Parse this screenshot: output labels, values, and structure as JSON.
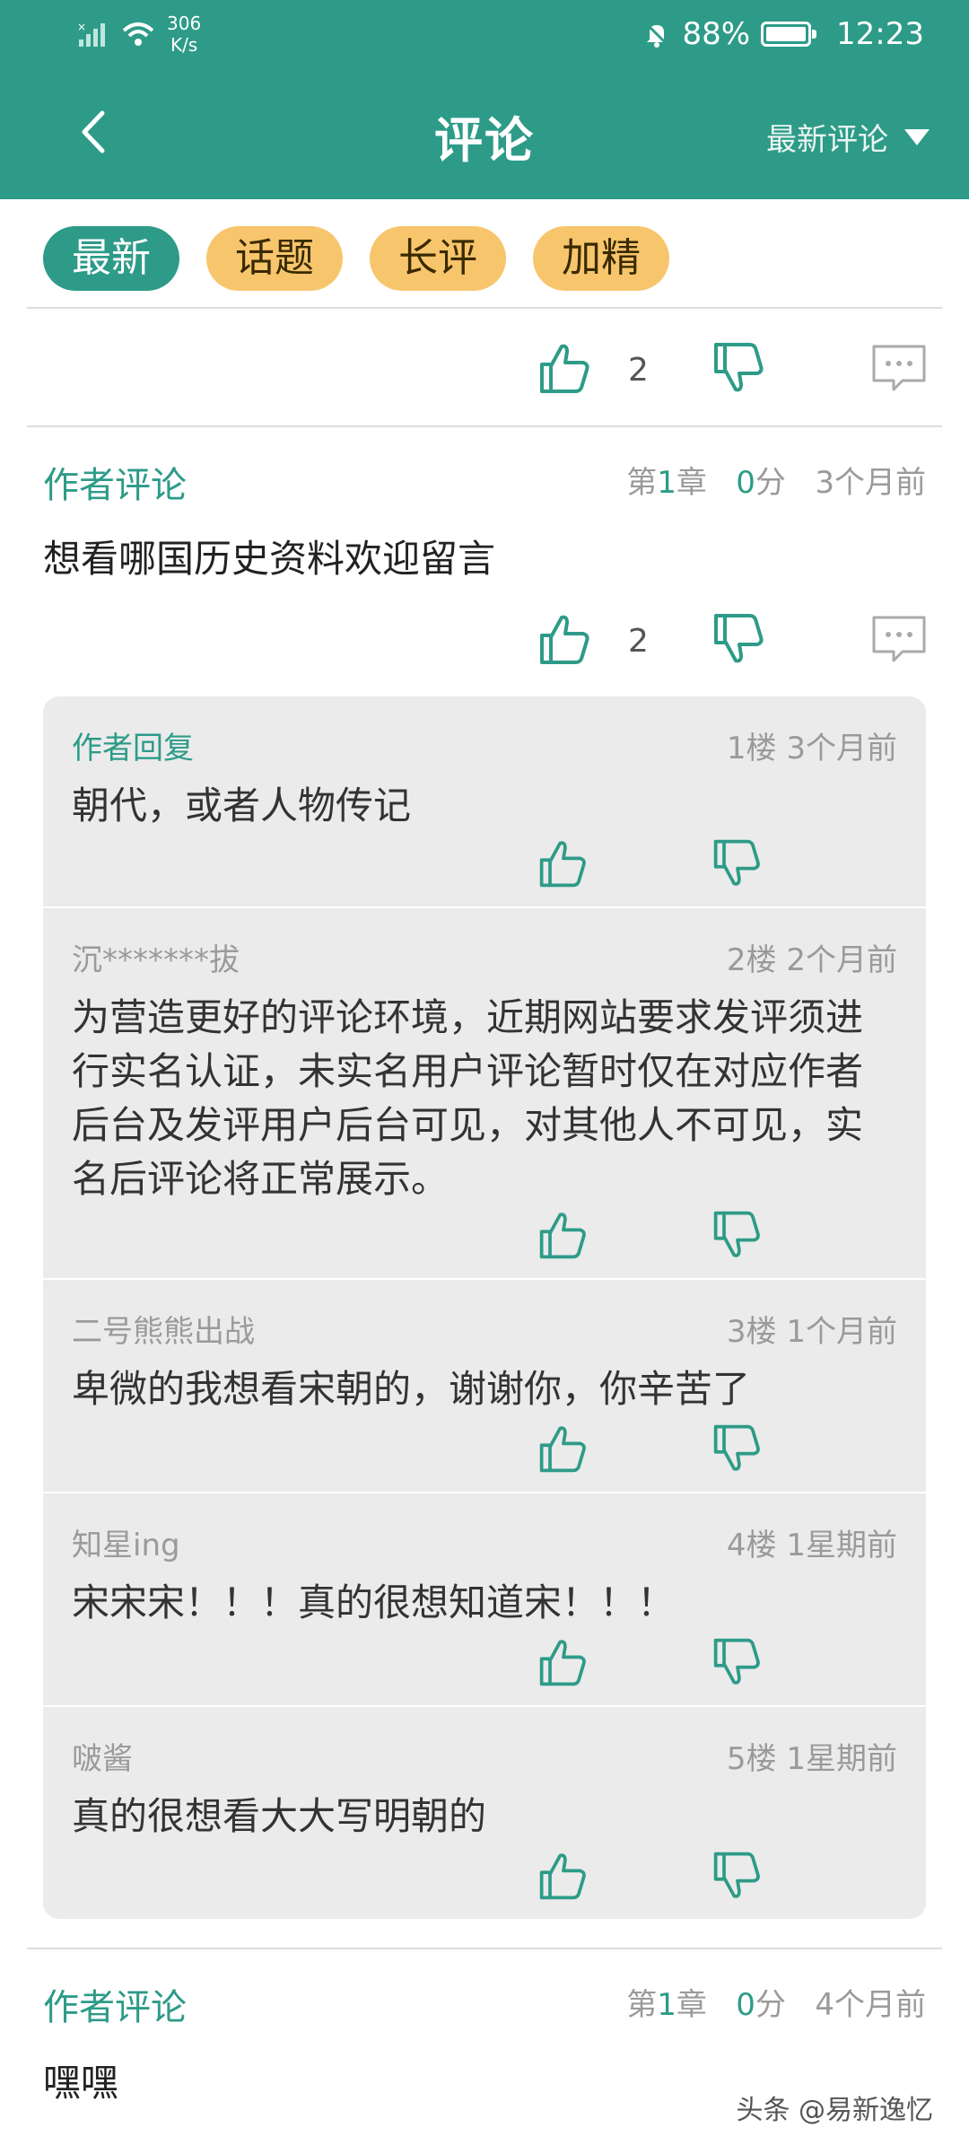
{
  "status": {
    "net_speed_value": "306",
    "net_speed_unit": "K/s",
    "battery": "88%",
    "time": "12:23"
  },
  "header": {
    "title": "评论",
    "sort_label": "最新评论"
  },
  "chips": [
    {
      "label": "最新",
      "active": true
    },
    {
      "label": "话题",
      "active": false
    },
    {
      "label": "长评",
      "active": false
    },
    {
      "label": "加精",
      "active": false
    }
  ],
  "top_actions": {
    "like_count": "2"
  },
  "comment1": {
    "tag": "作者评论",
    "chapter_prefix": "第",
    "chapter_num": "1",
    "chapter_suffix": "章",
    "score_num": "0",
    "score_suffix": "分",
    "time": "3个月前",
    "text": "想看哪国历史资料欢迎留言",
    "like_count": "2"
  },
  "replies": [
    {
      "name": "作者回复",
      "floor": "1楼",
      "time": "3个月前",
      "text": "朝代，或者人物传记"
    },
    {
      "name": "沉*******拔",
      "floor": "2楼",
      "time": "2个月前",
      "text": "为营造更好的评论环境，近期网站要求发评须进行实名认证，未实名用户评论暂时仅在对应作者后台及发评用户后台可见，对其他人不可见，实名后评论将正常展示。"
    },
    {
      "name": "二号熊熊出战",
      "floor": "3楼",
      "time": "1个月前",
      "text": "卑微的我想看宋朝的，谢谢你，你辛苦了"
    },
    {
      "name": "知星ing",
      "floor": "4楼",
      "time": "1星期前",
      "text": "宋宋宋！！！真的很想知道宋！！！"
    },
    {
      "name": "啵酱",
      "floor": "5楼",
      "time": "1星期前",
      "text": "真的很想看大大写明朝的"
    }
  ],
  "comment2": {
    "tag": "作者评论",
    "chapter_prefix": "第",
    "chapter_num": "1",
    "chapter_suffix": "章",
    "score_num": "0",
    "score_suffix": "分",
    "time": "4个月前",
    "text": "嘿嘿"
  },
  "watermark": "头条 @易新逸忆",
  "colors": {
    "brand": "#2d9b88",
    "chip": "#f7c56c",
    "reply_bg": "#ebebeb"
  }
}
